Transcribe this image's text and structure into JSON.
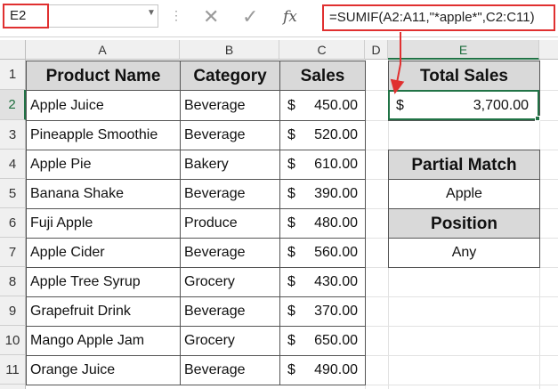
{
  "formula_bar": {
    "name_box": "E2",
    "cancel_icon": "cancel-x-icon",
    "enter_icon": "checkmark-icon",
    "fx_label": "fx",
    "formula": "=SUMIF(A2:A11,\"*apple*\",C2:C11)"
  },
  "columns": [
    "A",
    "B",
    "C",
    "D",
    "E"
  ],
  "rows": [
    "1",
    "2",
    "3",
    "4",
    "5",
    "6",
    "7",
    "8",
    "9",
    "10",
    "11"
  ],
  "table": {
    "headers": [
      "Product Name",
      "Category",
      "Sales"
    ],
    "rows": [
      {
        "product": "Apple Juice",
        "category": "Beverage",
        "currency": "$",
        "sales": "450.00"
      },
      {
        "product": "Pineapple Smoothie",
        "category": "Beverage",
        "currency": "$",
        "sales": "520.00"
      },
      {
        "product": "Apple Pie",
        "category": "Bakery",
        "currency": "$",
        "sales": "610.00"
      },
      {
        "product": "Banana Shake",
        "category": "Beverage",
        "currency": "$",
        "sales": "390.00"
      },
      {
        "product": "Fuji Apple",
        "category": "Produce",
        "currency": "$",
        "sales": "480.00"
      },
      {
        "product": "Apple Cider",
        "category": "Beverage",
        "currency": "$",
        "sales": "560.00"
      },
      {
        "product": "Apple Tree Syrup",
        "category": "Grocery",
        "currency": "$",
        "sales": "430.00"
      },
      {
        "product": "Grapefruit Drink",
        "category": "Beverage",
        "currency": "$",
        "sales": "370.00"
      },
      {
        "product": "Mango Apple Jam",
        "category": "Grocery",
        "currency": "$",
        "sales": "650.00"
      },
      {
        "product": "Orange Juice",
        "category": "Beverage",
        "currency": "$",
        "sales": "490.00"
      }
    ]
  },
  "total_sales": {
    "header": "Total Sales",
    "currency": "$",
    "value": "3,700.00"
  },
  "partial_match": {
    "header": "Partial Match",
    "value": "Apple"
  },
  "position": {
    "header": "Position",
    "value": "Any"
  },
  "colors": {
    "accent_red": "#e03030",
    "excel_green": "#217346",
    "header_fill": "#d9d9d9"
  }
}
